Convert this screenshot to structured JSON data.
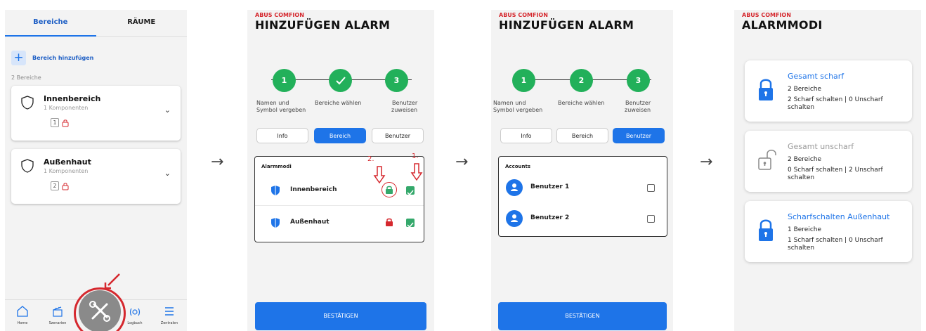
{
  "screen1": {
    "tabs": [
      "Bereiche",
      "RÄUME"
    ],
    "add_label": "Bereich hinzufügen",
    "count_label": "2 Bereiche",
    "areas": [
      {
        "name": "Innenbereich",
        "sub": "1 Komponenten",
        "badge": "1"
      },
      {
        "name": "Außenhaut",
        "sub": "1 Komponenten",
        "badge": "2"
      }
    ],
    "nav": [
      "Home",
      "Szenarien",
      "Logbuch",
      "Zentralen"
    ],
    "highlight_color": "#d5282e"
  },
  "screen2": {
    "brand": "ABUS COMFION",
    "title": "HINZUFÜGEN ALARM",
    "steps": [
      {
        "label": "Namen und\nSymbol vergeben",
        "value": "1"
      },
      {
        "label": "Bereiche wählen",
        "value": "check"
      },
      {
        "label": "Benutzer\nzuweisen",
        "value": "3"
      }
    ],
    "segments": [
      "Info",
      "Bereich",
      "Benutzer"
    ],
    "box_title": "Alarmmodi",
    "rows": [
      "Innenbereich",
      "Außenhaut"
    ],
    "annotations": [
      "2.",
      "1."
    ],
    "confirm": "BESTÄTIGEN"
  },
  "screen3": {
    "brand": "ABUS COMFION",
    "title": "HINZUFÜGEN ALARM",
    "steps": [
      {
        "label": "Namen und\nSymbol vergeben",
        "value": "1"
      },
      {
        "label": "Bereiche wählen",
        "value": "2"
      },
      {
        "label": "Benutzer\nzuweisen",
        "value": "3"
      }
    ],
    "segments": [
      "Info",
      "Bereich",
      "Benutzer"
    ],
    "box_title": "Accounts",
    "rows": [
      "Benutzer 1",
      "Benutzer 2"
    ],
    "confirm": "BESTÄTIGEN"
  },
  "screen4": {
    "brand": "ABUS COMFION",
    "title": "ALARMMODI",
    "modes": [
      {
        "title": "Gesamt scharf",
        "line1": "2 Bereiche",
        "line2": "2 Scharf schalten | 0 Unscharf schalten",
        "state": "locked",
        "title_color": "#1e74e8"
      },
      {
        "title": "Gesamt unscharf",
        "line1": "2 Bereiche",
        "line2": "0 Scharf schalten | 2 Unscharf schalten",
        "state": "unlocked",
        "title_color": "#9a9a9a"
      },
      {
        "title": "Scharfschalten Außenhaut",
        "line1": "1 Bereiche",
        "line2": "1 Scharf schalten | 0 Unscharf schalten",
        "state": "locked",
        "title_color": "#1e74e8"
      }
    ]
  },
  "flow_arrow": "→",
  "colors": {
    "primary": "#1e74e8",
    "step_green": "#22b05a",
    "check_green": "#34a86b",
    "brand_red": "#d5282e"
  }
}
